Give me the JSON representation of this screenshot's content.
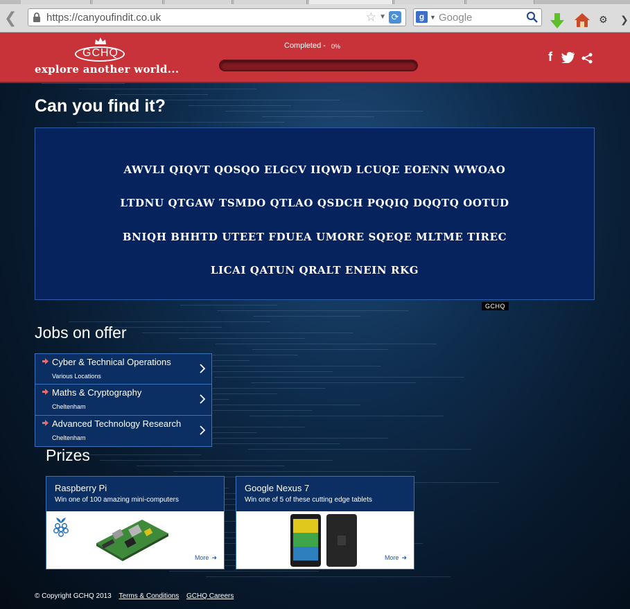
{
  "browser": {
    "url": "https://canyoufindit.co.uk",
    "search_placeholder": "Google",
    "search_engine_letter": "g"
  },
  "header": {
    "logo_text": "GCHQ",
    "tagline": "explore another world...",
    "progress_label": "Completed -",
    "progress_pct": "0%",
    "progress_value": 0,
    "accent_color": "#c8333a"
  },
  "main": {
    "title": "Can you find it?",
    "cipher_lines": [
      "AWVLI QIQVT QOSQO ELGCV IIQWD LCUQE EOENN WWOAO",
      "LTDNU QTGAW TSMDO QTLAO QSDCH PQQIQ DQQTQ OOTUD",
      "BNIQH BHHTD UTEET FDUEA UMORE SQEQE MLTME TIREC",
      "LICAI QATUN QRALT ENEIN RKG"
    ],
    "cipher_watermark": "GCHQ"
  },
  "jobs": {
    "title": "Jobs on offer",
    "items": [
      {
        "title": "Cyber & Technical Operations",
        "location": "Various Locations"
      },
      {
        "title": "Maths & Cryptography",
        "location": "Cheltenham"
      },
      {
        "title": "Advanced Technology Research",
        "location": "Cheltenham"
      }
    ]
  },
  "prizes": {
    "title": "Prizes",
    "items": [
      {
        "name": "Raspberry Pi",
        "desc": "Win one of 100 amazing mini-computers",
        "more": "More"
      },
      {
        "name": "Google Nexus 7",
        "desc": "Win one of 5 of these cutting edge tablets",
        "more": "More"
      }
    ]
  },
  "footer": {
    "copyright": "© Copyright GCHQ 2013",
    "terms": "Terms & Conditions",
    "careers": "GCHQ Careers"
  }
}
